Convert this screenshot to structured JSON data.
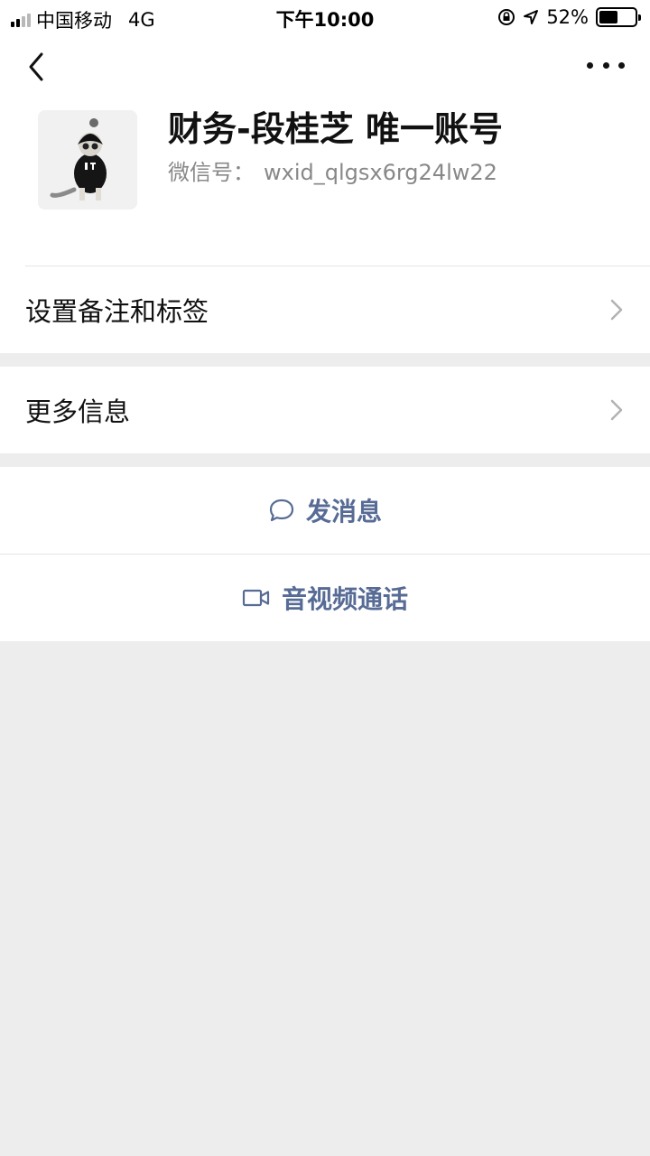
{
  "status_bar": {
    "carrier": "中国移动",
    "network": "4G",
    "time": "下午10:00",
    "battery_percent": "52%",
    "battery_level": 0.52
  },
  "nav": {
    "back_icon": "chevron-left-icon",
    "more_icon": "ellipsis-icon"
  },
  "profile": {
    "name": "财务-段桂芝 唯一账号",
    "wxid_label": "微信号：",
    "wxid_value": "wxid_qlgsx6rg24lw22"
  },
  "cells": {
    "remark_label": "设置备注和标签",
    "more_info_label": "更多信息"
  },
  "actions": {
    "message_label": "发消息",
    "call_label": "音视频通话"
  },
  "colors": {
    "link": "#576b95",
    "background": "#ededed"
  }
}
